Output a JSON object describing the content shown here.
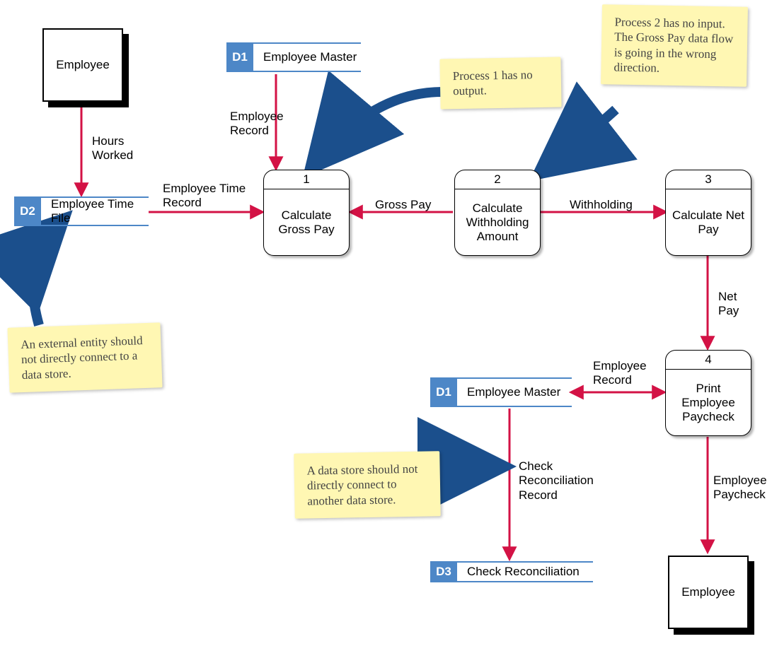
{
  "entities": {
    "employee_src": "Employee",
    "employee_dst": "Employee"
  },
  "processes": {
    "p1": {
      "num": "1",
      "name": "Calculate Gross Pay"
    },
    "p2": {
      "num": "2",
      "name": "Calculate Withholding Amount"
    },
    "p3": {
      "num": "3",
      "name": "Calculate Net Pay"
    },
    "p4": {
      "num": "4",
      "name": "Print Employee Paycheck"
    }
  },
  "datastores": {
    "d1_top": {
      "tag": "D1",
      "name": "Employee Master"
    },
    "d2": {
      "tag": "D2",
      "name": "Employee Time File"
    },
    "d1_mid": {
      "tag": "D1",
      "name": "Employee Master"
    },
    "d3": {
      "tag": "D3",
      "name": "Check Reconciliation"
    }
  },
  "flows": {
    "hours_worked": "Hours Worked",
    "employee_record_top": "Employee Record",
    "employee_time_record": "Employee Time Record",
    "gross_pay": "Gross Pay",
    "withholding": "Withholding",
    "net_pay": "Net Pay",
    "employee_record_mid": "Employee Record",
    "employee_paycheck": "Employee Paycheck",
    "check_reconciliation_record": "Check Reconciliation Record"
  },
  "notes": {
    "n1": "Process 1 has no output.",
    "n2": "Process 2 has no input. The Gross Pay data flow is going in the wrong direction.",
    "n3": "An external entity should not directly connect to a data store.",
    "n4": "A data store should not directly connect to another data store."
  },
  "colors": {
    "arrow_red": "#D31245",
    "arrow_blue": "#1B4F8C",
    "datastore_blue": "#4D87C7",
    "note_bg": "#FFF7B3"
  }
}
